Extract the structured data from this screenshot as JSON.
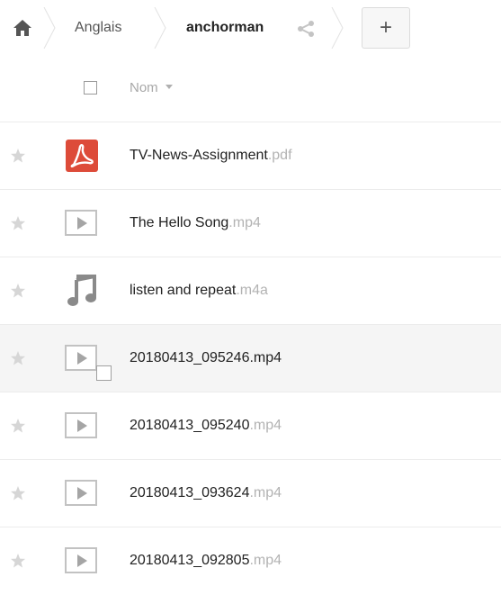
{
  "breadcrumb": {
    "home_icon": "home-icon",
    "parent": "Anglais",
    "current": "anchorman",
    "share_icon": "share-icon"
  },
  "toolbar": {
    "add_label": "+"
  },
  "header": {
    "sort_label": "Nom"
  },
  "files": [
    {
      "base": "TV-News-Assignment",
      "ext": ".pdf",
      "type": "pdf",
      "icon": "pdf-icon"
    },
    {
      "base": "The Hello Song",
      "ext": ".mp4",
      "type": "video",
      "icon": "video-icon"
    },
    {
      "base": "listen and repeat",
      "ext": ".m4a",
      "type": "audio",
      "icon": "music-icon"
    },
    {
      "base": "20180413_095246",
      "ext": ".mp4",
      "type": "video",
      "icon": "video-icon",
      "hovered": true
    },
    {
      "base": "20180413_095240",
      "ext": ".mp4",
      "type": "video",
      "icon": "video-icon"
    },
    {
      "base": "20180413_093624",
      "ext": ".mp4",
      "type": "video",
      "icon": "video-icon"
    },
    {
      "base": "20180413_092805",
      "ext": ".mp4",
      "type": "video",
      "icon": "video-icon"
    }
  ],
  "colors": {
    "pdf_red": "#dd4b39",
    "icon_grey": "#a5a5a5",
    "star_grey": "#d6d6d6",
    "ext_grey": "#b3b3b3"
  }
}
